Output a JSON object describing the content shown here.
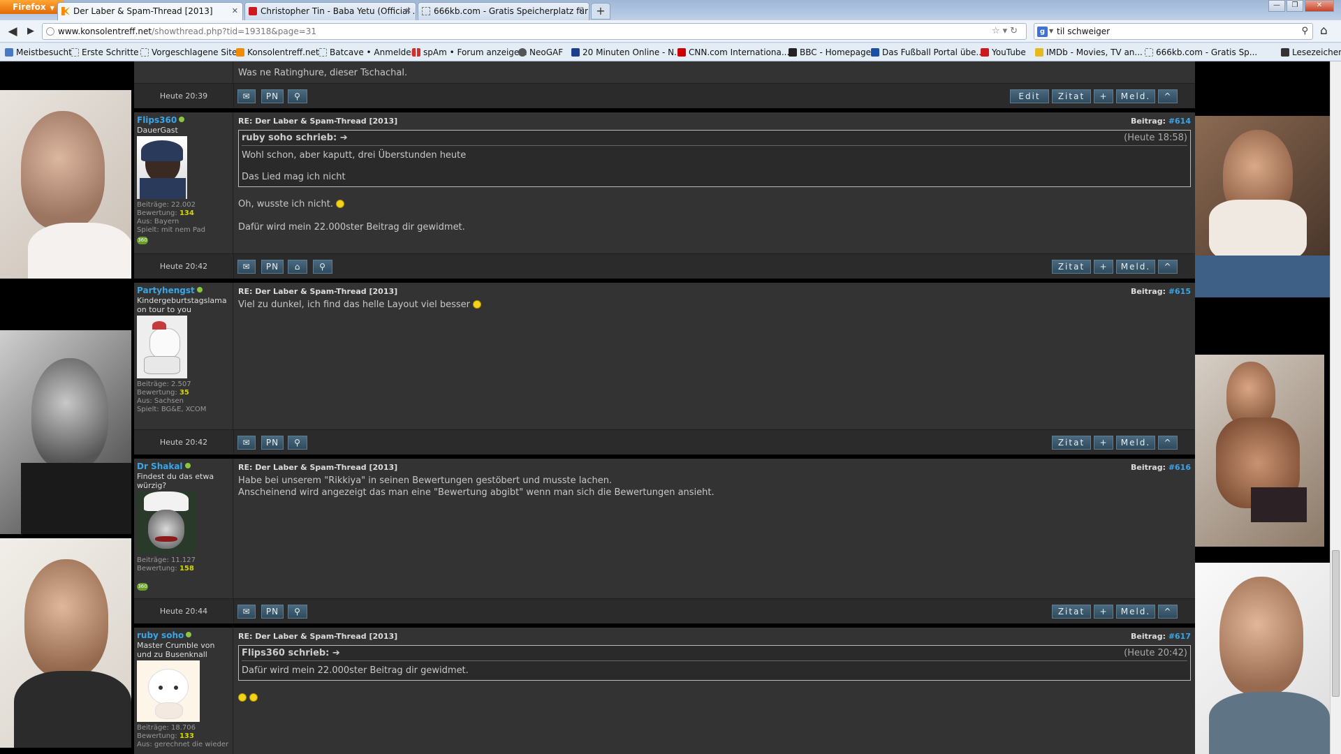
{
  "browser": {
    "menu_button": "Firefox",
    "tabs": [
      {
        "title": "Der Laber & Spam-Thread [2013]",
        "active": true,
        "favicon": "konsolentreff-icon"
      },
      {
        "title": "Christopher Tin - Baba Yetu (Official ...",
        "active": false,
        "favicon": "youtube-icon"
      },
      {
        "title": "666kb.com - Gratis Speicherplatz für ...",
        "active": false,
        "favicon": "page-icon"
      }
    ],
    "new_tab": "+",
    "url_host": "www.konsolentreff.net",
    "url_path": "/showthread.php?tid=19318&page=31",
    "search_engine": "g",
    "search_text": "til schweiger",
    "bookmarks": [
      {
        "label": "Meistbesucht",
        "icon": "gear-icon"
      },
      {
        "label": "Erste Schritte",
        "icon": "page-icon"
      },
      {
        "label": "Vorgeschlagene Sites",
        "icon": "page-icon"
      },
      {
        "label": "Konsolentreff.net",
        "icon": "konsolentreff-icon"
      },
      {
        "label": "Batcave • Anmelden",
        "icon": "page-icon"
      },
      {
        "label": "spAm • Forum anzeige...",
        "icon": "bars-icon"
      },
      {
        "label": "NeoGAF",
        "icon": "neogaf-icon"
      },
      {
        "label": "20 Minuten Online - N...",
        "icon": "20min-icon"
      },
      {
        "label": "CNN.com Internationa...",
        "icon": "cnn-icon"
      },
      {
        "label": "BBC - Homepage",
        "icon": "bbc-icon"
      },
      {
        "label": "Das Fußball Portal übe...",
        "icon": "kicker-icon"
      },
      {
        "label": "YouTube",
        "icon": "youtube-icon"
      },
      {
        "label": "IMDb - Movies, TV an...",
        "icon": "imdb-icon"
      },
      {
        "label": "666kb.com - Gratis Sp...",
        "icon": "page-icon"
      }
    ],
    "bookmarks_menu": "Lesezeichen"
  },
  "thread": {
    "prev_post": {
      "text_tail": "Was ne Ratinghure, dieser Tschachal.",
      "time": "Heute 20:39",
      "buttons_left": [
        "PN"
      ],
      "buttons_right": [
        "Edit",
        "Zitat",
        "+",
        "Meld.",
        "^"
      ]
    },
    "posts": [
      {
        "user": "Flips360",
        "user_title": "DauerGast",
        "stats": [
          "Beiträge: 22.002"
        ],
        "rating_label": "Bewertung:",
        "rating": "134",
        "extra": [
          "Aus: Bayern",
          "Spielt: mit nem Pad"
        ],
        "xbl": "360",
        "subject": "RE: Der Laber & Spam-Thread [2013]",
        "post_label": "Beitrag:",
        "post_num": "#614",
        "quote": {
          "author": "ruby soho schrieb:",
          "time": "(Heute 18:58)",
          "lines": [
            "Wohl schon, aber kaputt, drei Überstunden heute",
            "Das Lied mag ich nicht"
          ]
        },
        "body": [
          "Oh, wusste ich nicht.",
          "Dafür wird mein 22.000ster Beitrag dir gewidmet."
        ],
        "time": "Heute 20:42"
      },
      {
        "user": "Partyhengst",
        "user_title": "Kindergeburtstagslama on tour to you",
        "stats": [
          "Beiträge: 2.507"
        ],
        "rating_label": "Bewertung:",
        "rating": "35",
        "extra": [
          "Aus: Sachsen",
          "Spielt: BG&E, XCOM"
        ],
        "subject": "RE: Der Laber & Spam-Thread [2013]",
        "post_label": "Beitrag:",
        "post_num": "#615",
        "body": [
          "Viel zu dunkel, ich find das helle Layout viel besser"
        ],
        "time": "Heute 20:42"
      },
      {
        "user": "Dr Shakal",
        "user_title": "Findest du das etwa würzig?",
        "stats": [
          "Beiträge: 11.127"
        ],
        "rating_label": "Bewertung:",
        "rating": "158",
        "xbl": "360",
        "subject": "RE: Der Laber & Spam-Thread [2013]",
        "post_label": "Beitrag:",
        "post_num": "#616",
        "body": [
          "Habe bei unserem \"Rikkiya\" in seinen Bewertungen gestöbert und musste lachen.",
          "Anscheinend wird angezeigt das man eine \"Bewertung abgibt\" wenn man sich die Bewertungen ansieht."
        ],
        "time": "Heute 20:44"
      },
      {
        "user": "ruby soho",
        "user_title": "Master Crumble von und zu Busenknall",
        "stats": [
          "Beiträge: 18.706"
        ],
        "rating_label": "Bewertung:",
        "rating": "133",
        "extra": [
          "Aus: gerechnet die wieder"
        ],
        "subject": "RE: Der Laber & Spam-Thread [2013]",
        "post_label": "Beitrag:",
        "post_num": "#617",
        "quote": {
          "author": "Flips360 schrieb:",
          "time": "(Heute 20:42)",
          "lines": [
            "Dafür wird mein 22.000ster Beitrag dir gewidmet."
          ]
        }
      }
    ],
    "buttons": {
      "pn": "PN",
      "edit": "Edit",
      "quote": "Zitat",
      "plus": "+",
      "report": "Meld.",
      "up": "^"
    }
  },
  "colors": {
    "username": "#39a6e8",
    "rating": "#d6d600",
    "post_bg": "#333333",
    "button": "#3f5d72"
  }
}
